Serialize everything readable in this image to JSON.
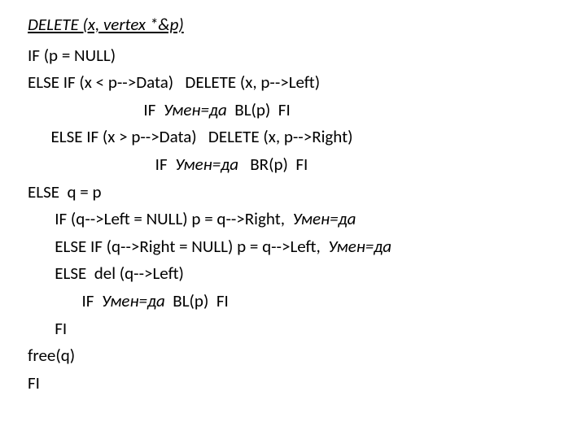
{
  "doc": {
    "title": "DELETE (x, vertex *&p)",
    "lines": {
      "l1": "IF (p = NULL)",
      "l2a": "ELSE IF (x < p-->Data)   DELETE (x, p-->Left)",
      "l3a": "                              IF  ",
      "l3b": "Умен=да",
      "l3c": "  BL(p)  FI",
      "l4": "      ELSE IF (x > p-->Data)   DELETE (x, p-->Right)",
      "l5a": "                                 IF  ",
      "l5b": "Умен=да",
      "l5c": "   BR(p)  FI",
      "l6": "ELSE  q = p",
      "l7a": "       IF (q-->Left = NULL) p = q-->Right,  ",
      "l7b": "Умен=да",
      "l8a": "       ELSE IF (q-->Right = NULL) p = q-->Left,  ",
      "l8b": "Умен=да",
      "l9": "       ELSE  del (q-->Left)",
      "l10a": "              IF  ",
      "l10b": "Умен=да",
      "l10c": "  BL(p)  FI",
      "l11": "       FI",
      "l12": "free(q)",
      "l13": "FI"
    }
  }
}
